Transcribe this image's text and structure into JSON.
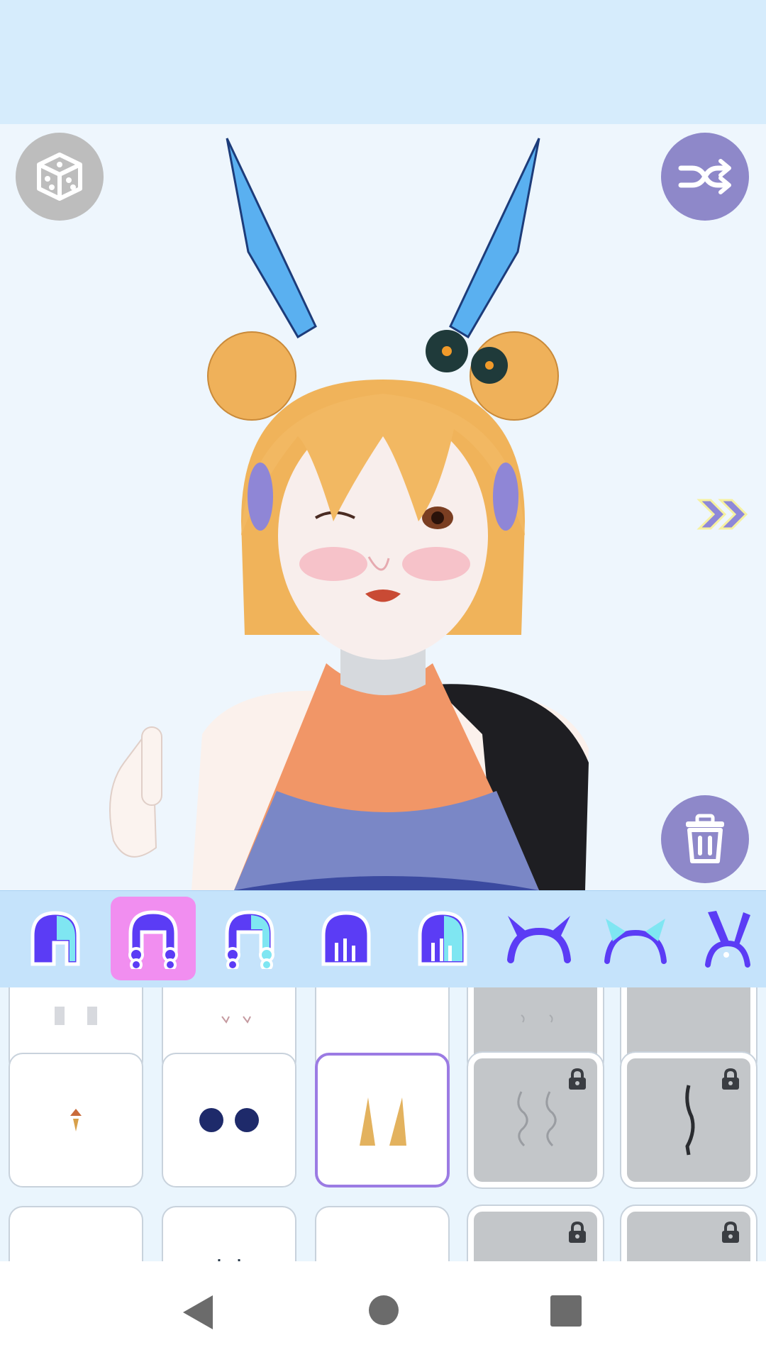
{
  "toolbar": {
    "random_icon": "dice-icon",
    "shuffle_icon": "shuffle-icon",
    "delete_icon": "trash-icon",
    "next_icon": "double-chevron-right-icon"
  },
  "categories": [
    {
      "icon": "hair-side-icon",
      "active": false
    },
    {
      "icon": "hair-braids-icon",
      "active": true
    },
    {
      "icon": "hair-twin-tails-icon",
      "active": false
    },
    {
      "icon": "hair-bangs-icon",
      "active": false
    },
    {
      "icon": "hair-half-icon",
      "active": false
    },
    {
      "icon": "horns-headband-icon",
      "active": false
    },
    {
      "icon": "headband-icon",
      "active": false
    },
    {
      "icon": "bunny-ears-icon",
      "active": false
    }
  ],
  "items": {
    "row1": [
      {
        "locked": false,
        "selected": false
      },
      {
        "locked": false,
        "selected": false
      },
      {
        "locked": false,
        "selected": false
      },
      {
        "locked": true,
        "selected": false
      },
      {
        "locked": true,
        "selected": false
      }
    ],
    "row2": [
      {
        "locked": false,
        "selected": false,
        "content": "tiny-flower-ornament"
      },
      {
        "locked": false,
        "selected": false,
        "content": "navy-hair-buns"
      },
      {
        "locked": false,
        "selected": true,
        "content": "golden-horns"
      },
      {
        "locked": true,
        "selected": false,
        "content": "silver-curl-strands"
      },
      {
        "locked": true,
        "selected": false,
        "content": "dark-single-braid"
      }
    ],
    "row3": [
      {
        "locked": false,
        "selected": false
      },
      {
        "locked": false,
        "selected": false
      },
      {
        "locked": false,
        "selected": false
      },
      {
        "locked": true,
        "selected": false
      },
      {
        "locked": true,
        "selected": false
      }
    ]
  },
  "colors": {
    "accent": "#8e88c9",
    "active_category": "#f18ef0",
    "icon_purple": "#5b3cf5",
    "selected_border": "#9b7be3"
  },
  "navigation": {
    "back_icon": "back-triangle-icon",
    "home_icon": "home-circle-icon",
    "recents_icon": "recents-square-icon"
  }
}
